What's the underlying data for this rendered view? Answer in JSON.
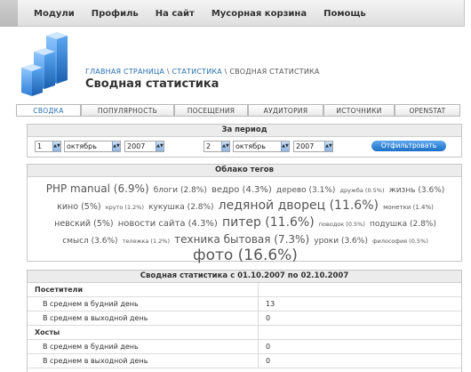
{
  "nav": [
    "Модули",
    "Профиль",
    "На сайт",
    "Мусорная корзина",
    "Помощь"
  ],
  "breadcrumb": {
    "home": "ГЛАВНАЯ СТРАНИЦА",
    "sep1": " \\ ",
    "stats": "СТАТИСТИКА",
    "sep2": " \\ ",
    "current": "СВОДНАЯ СТАТИСТИКА"
  },
  "page_title": "Сводная статистика",
  "tabs": [
    "СВОДКА",
    "ПОПУЛЯРНОСТЬ",
    "ПОСЕЩЕНИЯ",
    "АУДИТОРИЯ",
    "ИСТОЧНИКИ",
    "OPENSTAT"
  ],
  "active_tab": "СВОДКА",
  "period": {
    "heading": "За период",
    "from": {
      "day": "1",
      "month": "октябрь",
      "year": "2007"
    },
    "to": {
      "day": "2",
      "month": "октябрь",
      "year": "2007"
    },
    "filter_button": "Отфильтровать"
  },
  "tag_cloud": {
    "heading": "Облако тегов",
    "tags": [
      {
        "text": "PHP manual (6.9%)",
        "size": 12
      },
      {
        "text": "блоги (2.8%)",
        "size": 9
      },
      {
        "text": "ведро (4.3%)",
        "size": 10
      },
      {
        "text": "дерево (3.1%)",
        "size": 9
      },
      {
        "text": "дружба (0.5%)",
        "size": 6.5
      },
      {
        "text": "жизнь (3.6%)",
        "size": 9
      },
      {
        "text": "кино (5%)",
        "size": 9.5
      },
      {
        "text": "круто (1.2%)",
        "size": 6.5
      },
      {
        "text": "кукушка (2.8%)",
        "size": 9
      },
      {
        "text": "ледяной дворец (11.6%)",
        "size": 14
      },
      {
        "text": "монетки (1.4%)",
        "size": 7
      },
      {
        "text": "невский (5%)",
        "size": 9.5
      },
      {
        "text": "новости сайта (4.3%)",
        "size": 10
      },
      {
        "text": "питер (11.6%)",
        "size": 14
      },
      {
        "text": "поводок (0.5%)",
        "size": 6.5
      },
      {
        "text": "подушка (2.8%)",
        "size": 9
      },
      {
        "text": "смысл (3.6%)",
        "size": 9
      },
      {
        "text": "тележка (1.2%)",
        "size": 6.5
      },
      {
        "text": "техника бытовая (7.3%)",
        "size": 12
      },
      {
        "text": "уроки (3.6%)",
        "size": 9
      },
      {
        "text": "философия (0.5%)",
        "size": 6.5
      },
      {
        "text": "фото (16.6%)",
        "size": 17
      }
    ]
  },
  "summary": {
    "heading": "Сводная статистика с 01.10.2007 по 02.10.2007",
    "rows": [
      {
        "label": "Посетители",
        "value": "",
        "group": true
      },
      {
        "label": "В среднем в будний день",
        "value": "13",
        "group": false
      },
      {
        "label": "В среднем в выходной день",
        "value": "0",
        "group": false
      },
      {
        "label": "Хосты",
        "value": "",
        "group": true
      },
      {
        "label": "В среднем в будний день",
        "value": "0",
        "group": false
      },
      {
        "label": "В среднем в выходной день",
        "value": "0",
        "group": false
      }
    ]
  },
  "colors": {
    "link": "#2a6fb0",
    "button": "#1b6fc6",
    "logo": "#3a8fe0"
  },
  "icons": {
    "logo": "bar-chart-cubes-logo",
    "select_arrow": "spinner-arrows-icon"
  }
}
